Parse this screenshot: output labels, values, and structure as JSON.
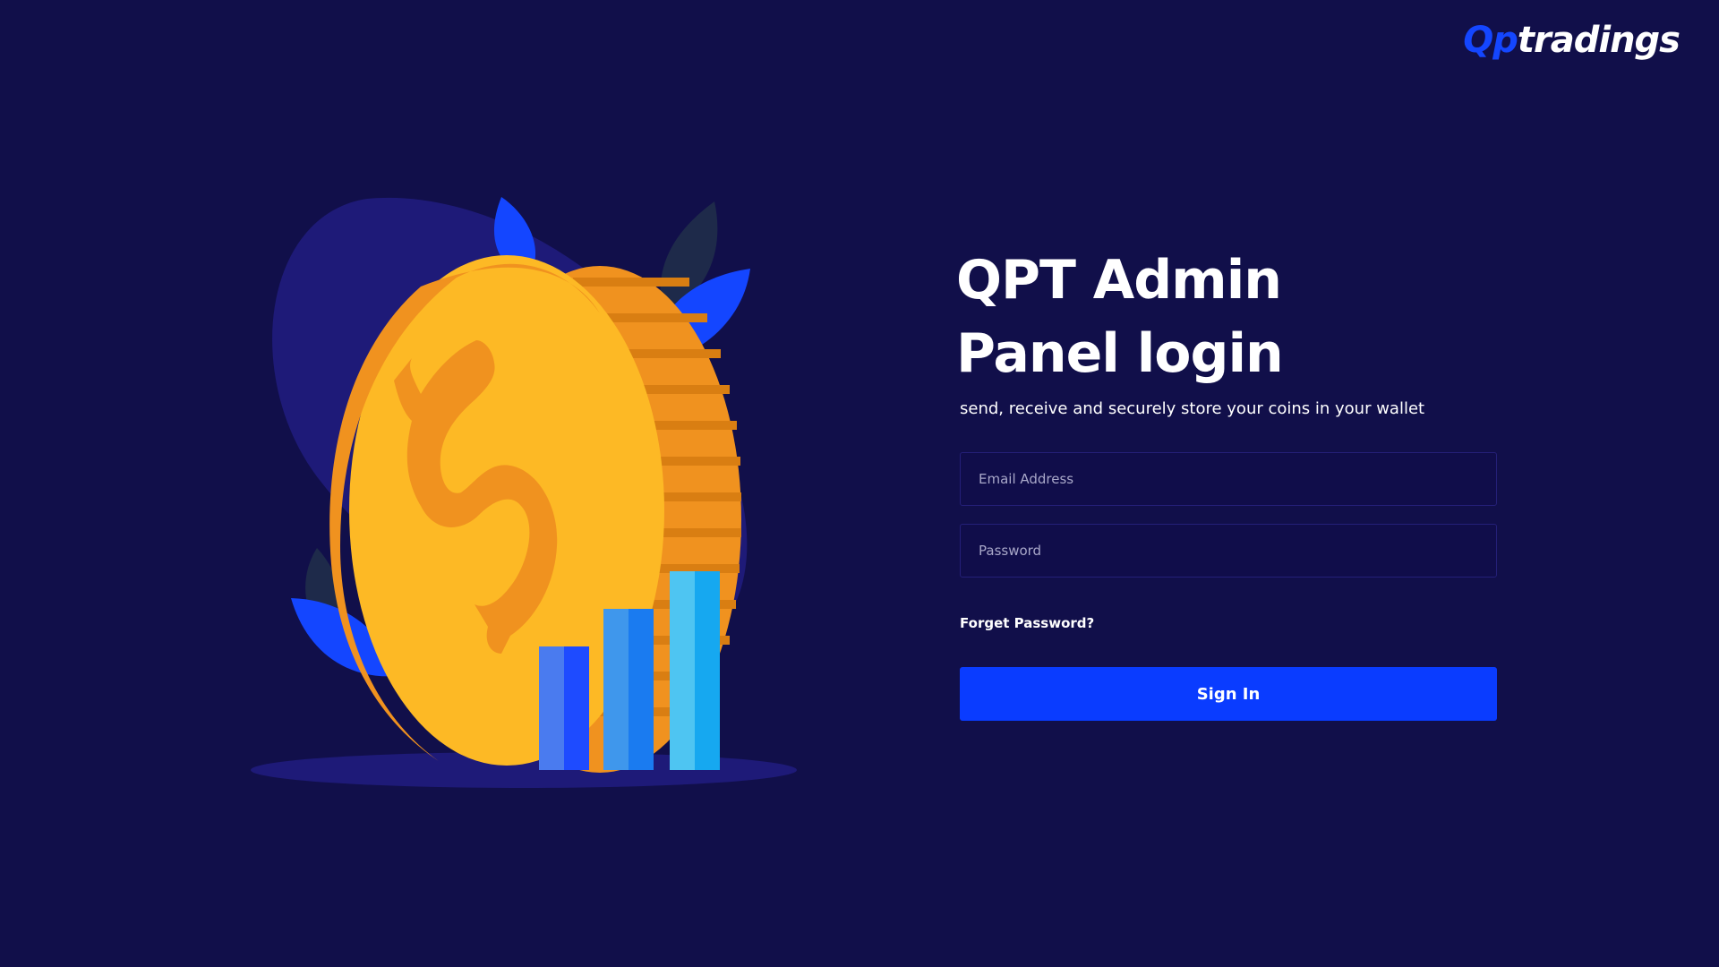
{
  "brand": {
    "logo_prefix": "Qp",
    "logo_suffix": "tradings",
    "accent_color": "#1446ff",
    "background_color": "#110f4a"
  },
  "login": {
    "title": "QPT Admin Panel login",
    "subtitle": "send, receive and securely store your coins in your wallet",
    "email_placeholder": "Email Address",
    "password_placeholder": "Password",
    "forgot_label": "Forget Password?",
    "signin_label": "Sign In",
    "button_color": "#0a3cff"
  },
  "illustration": {
    "icons": [
      "gold-dollar-coin-icon",
      "bar-chart-icon",
      "leaf-icon"
    ]
  }
}
